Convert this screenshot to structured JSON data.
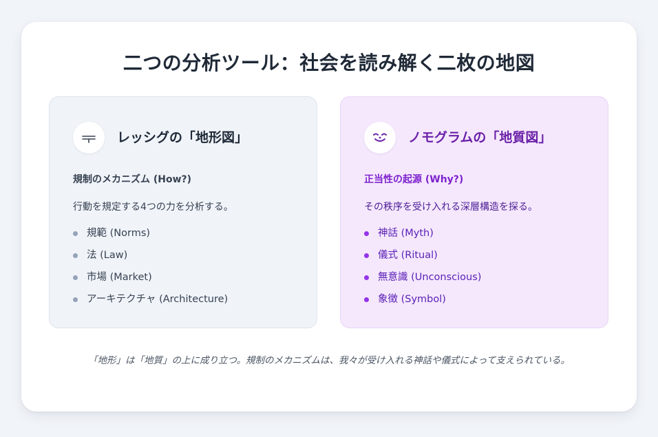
{
  "title": "二つの分析ツール：社会を読み解く二枚の地図",
  "left_panel": {
    "icon": "road-icon",
    "heading": "レッシグの「地形図」",
    "subheading": "規制のメカニズム (How?)",
    "description": "行動を規定する4つの力を分析する。",
    "items": [
      "規範 (Norms)",
      "法 (Law)",
      "市場 (Market)",
      "アーキテクチャ (Architecture)"
    ],
    "accent_color": "#94a3b8"
  },
  "right_panel": {
    "icon": "mask-icon",
    "heading": "ノモグラムの「地質図」",
    "subheading": "正当性の起源 (Why?)",
    "description": "その秩序を受け入れる深層構造を探る。",
    "items": [
      "神話 (Myth)",
      "儀式 (Ritual)",
      "無意識 (Unconscious)",
      "象徴 (Symbol)"
    ],
    "accent_color": "#9333ea"
  },
  "footer": "「地形」は「地質」の上に成り立つ。規制のメカニズムは、我々が受け入れる神話や儀式によって支えられている。"
}
